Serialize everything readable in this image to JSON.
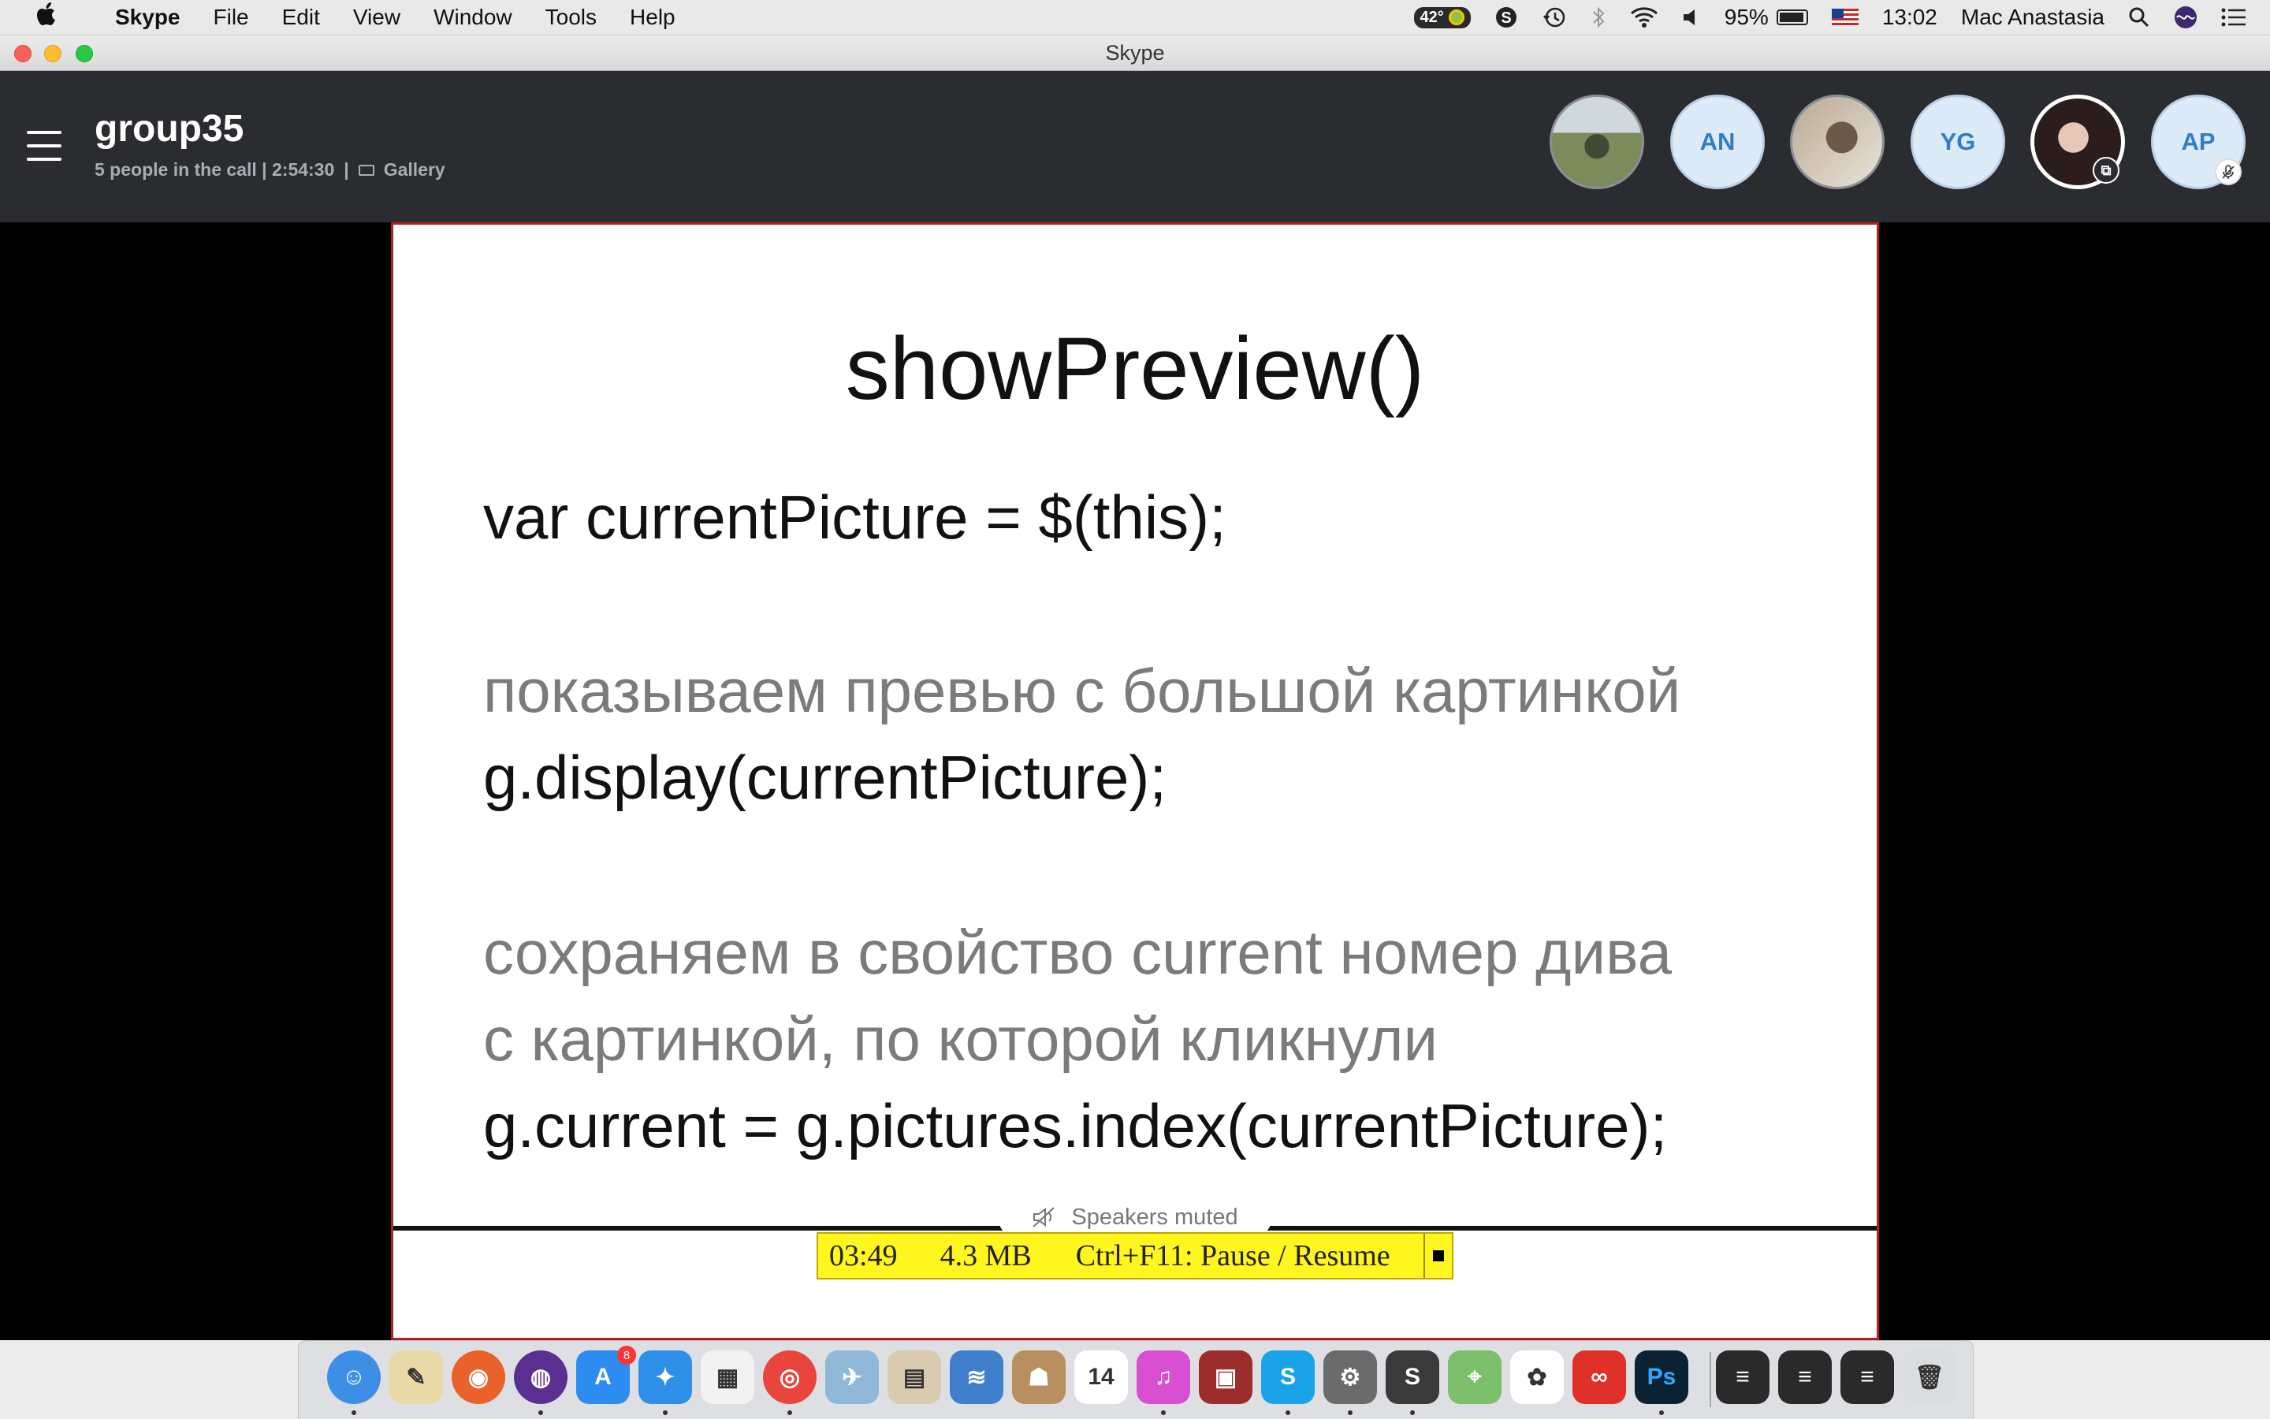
{
  "menubar": {
    "apple": "",
    "app_name": "Skype",
    "items": [
      "File",
      "Edit",
      "View",
      "Window",
      "Tools",
      "Help"
    ],
    "status": {
      "temperature": "42°",
      "battery": "95%",
      "battery_level": 0.95,
      "time": "13:02",
      "user": "Mac Anastasia"
    }
  },
  "window": {
    "title": "Skype"
  },
  "call": {
    "title": "group35",
    "people_info": "5 people in the call | 2:54:30",
    "separator": "|",
    "view_mode": "Gallery",
    "participants": [
      {
        "type": "photo",
        "name": "participant-photo-1"
      },
      {
        "type": "initials",
        "initials": "AN"
      },
      {
        "type": "photo",
        "name": "participant-photo-2"
      },
      {
        "type": "initials",
        "initials": "YG"
      },
      {
        "type": "photo",
        "name": "participant-photo-self",
        "icon": "popout-icon"
      },
      {
        "type": "initials",
        "initials": "AP",
        "icon": "mic-muted-icon"
      }
    ]
  },
  "slide": {
    "title": "showPreview()",
    "line1": "var currentPicture = $(this);",
    "comment1": "показываем превью с большой картинкой",
    "line2": "g.display(currentPicture);",
    "comment2a": "сохраняем в свойство current номер дива",
    "comment2b": "с картинкой, по которой кликнули",
    "line3": "g.current = g.pictures.index(currentPicture);"
  },
  "toast": {
    "text": "Speakers muted",
    "icon": "speaker-muted-icon"
  },
  "recorder": {
    "time": "03:49",
    "size": "4.3 MB",
    "hint": "Ctrl+F11: Pause / Resume"
  },
  "dock": {
    "apps": [
      {
        "name": "Finder",
        "color": "#3d8fe6",
        "glyph": "☺"
      },
      {
        "name": "TextEdit",
        "color": "#e9d9a6",
        "glyph": "✎"
      },
      {
        "name": "Firefox",
        "color": "#e9622b",
        "glyph": "◉"
      },
      {
        "name": "Siri",
        "color": "#5a2f8f",
        "glyph": "◍"
      },
      {
        "name": "App Store",
        "color": "#2c8cf0",
        "glyph": "A",
        "badge": "8"
      },
      {
        "name": "Safari",
        "color": "#2e8fe8",
        "glyph": "✦"
      },
      {
        "name": "Launchpad",
        "color": "#f2f2f2",
        "glyph": "▦"
      },
      {
        "name": "Chrome",
        "color": "#e8453c",
        "glyph": "◎"
      },
      {
        "name": "Preview",
        "color": "#8fb8d9",
        "glyph": "✈"
      },
      {
        "name": "Files",
        "color": "#d8cbb0",
        "glyph": "▤"
      },
      {
        "name": "FileZilla",
        "color": "#3f7fce",
        "glyph": "≋"
      },
      {
        "name": "Contacts",
        "color": "#b88f5e",
        "glyph": "☗"
      },
      {
        "name": "Calendar",
        "color": "#ffffff",
        "glyph": "14"
      },
      {
        "name": "iTunes",
        "color": "#d94fd1",
        "glyph": "♫"
      },
      {
        "name": "Photo Booth",
        "color": "#9b2d2d",
        "glyph": "▣"
      },
      {
        "name": "Skype",
        "color": "#1aa3e8",
        "glyph": "S"
      },
      {
        "name": "System Preferences",
        "color": "#6b6b6b",
        "glyph": "⚙"
      },
      {
        "name": "Sublime Text",
        "color": "#3a3a3a",
        "glyph": "S"
      },
      {
        "name": "Maps",
        "color": "#7cc06c",
        "glyph": "⌖"
      },
      {
        "name": "Photos",
        "color": "#ffffff",
        "glyph": "✿"
      },
      {
        "name": "Creative Cloud",
        "color": "#e0302a",
        "glyph": "∞"
      },
      {
        "name": "Photoshop",
        "color": "#0b2233",
        "glyph": "Ps"
      },
      {
        "name": "Window 1",
        "color": "#2a2a2a",
        "glyph": "≡"
      },
      {
        "name": "Window 2",
        "color": "#2a2a2a",
        "glyph": "≡"
      },
      {
        "name": "Window 3",
        "color": "#2a2a2a",
        "glyph": "≡"
      },
      {
        "name": "Trash",
        "color": "#dadde0",
        "glyph": "🗑"
      }
    ]
  }
}
